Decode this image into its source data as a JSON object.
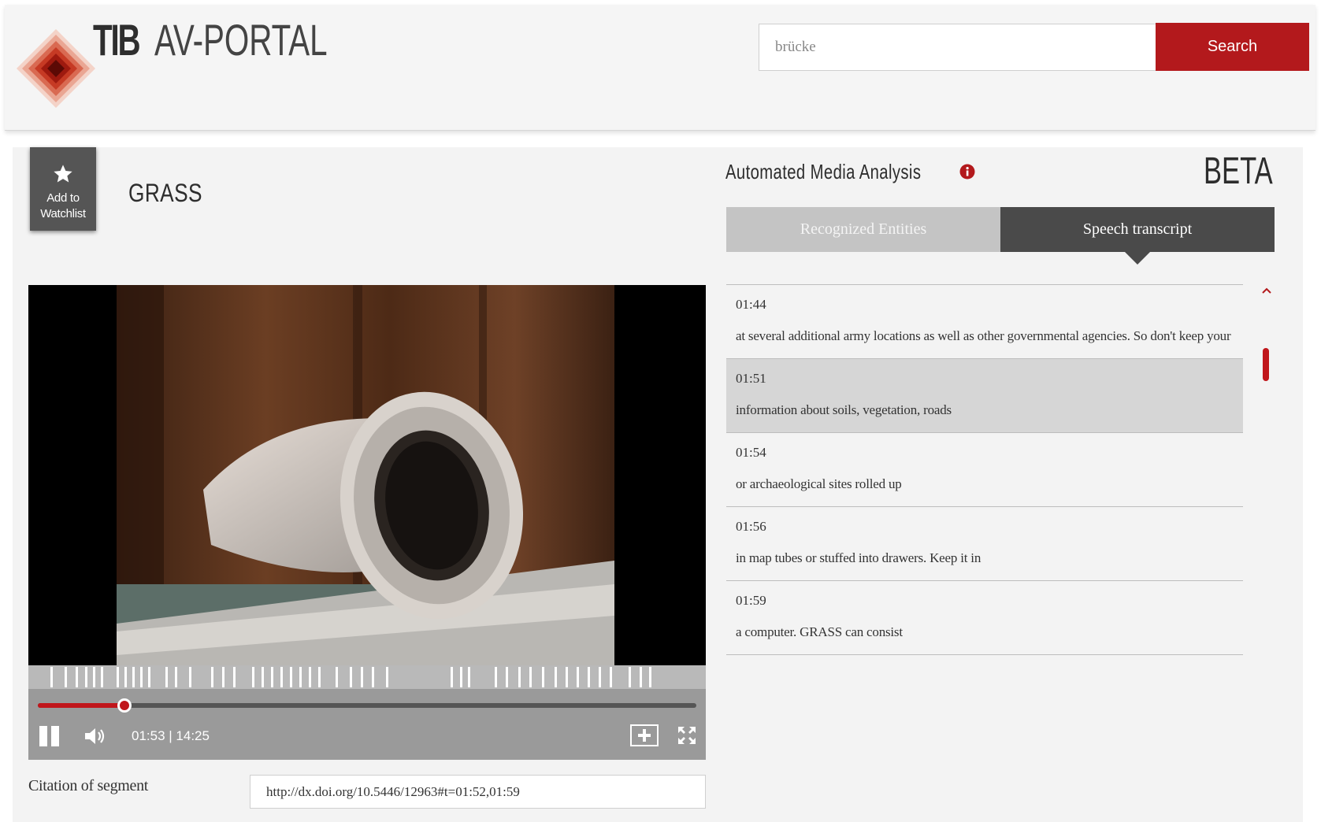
{
  "header": {
    "brand_tib": "TIB",
    "brand_portal": "AV-PORTAL",
    "search": {
      "value": "brücke",
      "button_label": "Search"
    }
  },
  "main": {
    "watchlist": {
      "line1": "Add to",
      "line2": "Watchlist"
    },
    "title": "GRASS"
  },
  "player": {
    "time_current": "01:53",
    "time_total": "14:25",
    "time_separator": " | ",
    "progress": 0.131,
    "state": "playing",
    "icons": [
      "pause-icon",
      "volume-icon",
      "add-clip-icon",
      "fullscreen-icon"
    ]
  },
  "citation": {
    "label": "Citation of segment",
    "value": "http://dx.doi.org/10.5446/12963#t=01:52,01:59"
  },
  "analysis": {
    "title": "Automated Media Analysis",
    "badge": "BETA",
    "tabs": [
      {
        "label": "Recognized Entities",
        "active": false
      },
      {
        "label": "Speech transcript",
        "active": true
      }
    ],
    "transcript": [
      {
        "time": "01:44",
        "text": "at several additional army locations as well as other governmental agencies. So don't keep your",
        "active": false
      },
      {
        "time": "01:51",
        "text": "information about soils, vegetation, roads",
        "active": true
      },
      {
        "time": "01:54",
        "text": "or archaeological sites rolled up",
        "active": false
      },
      {
        "time": "01:56",
        "text": "in map tubes or stuffed into drawers. Keep it in",
        "active": false
      },
      {
        "time": "01:59",
        "text": "a computer. GRASS can consist",
        "active": false
      }
    ]
  },
  "colors": {
    "accent": "#b3191c",
    "tab_active": "#4a4a4a",
    "tab_inactive": "#c4c4c4",
    "panel": "#f3f3f3"
  }
}
